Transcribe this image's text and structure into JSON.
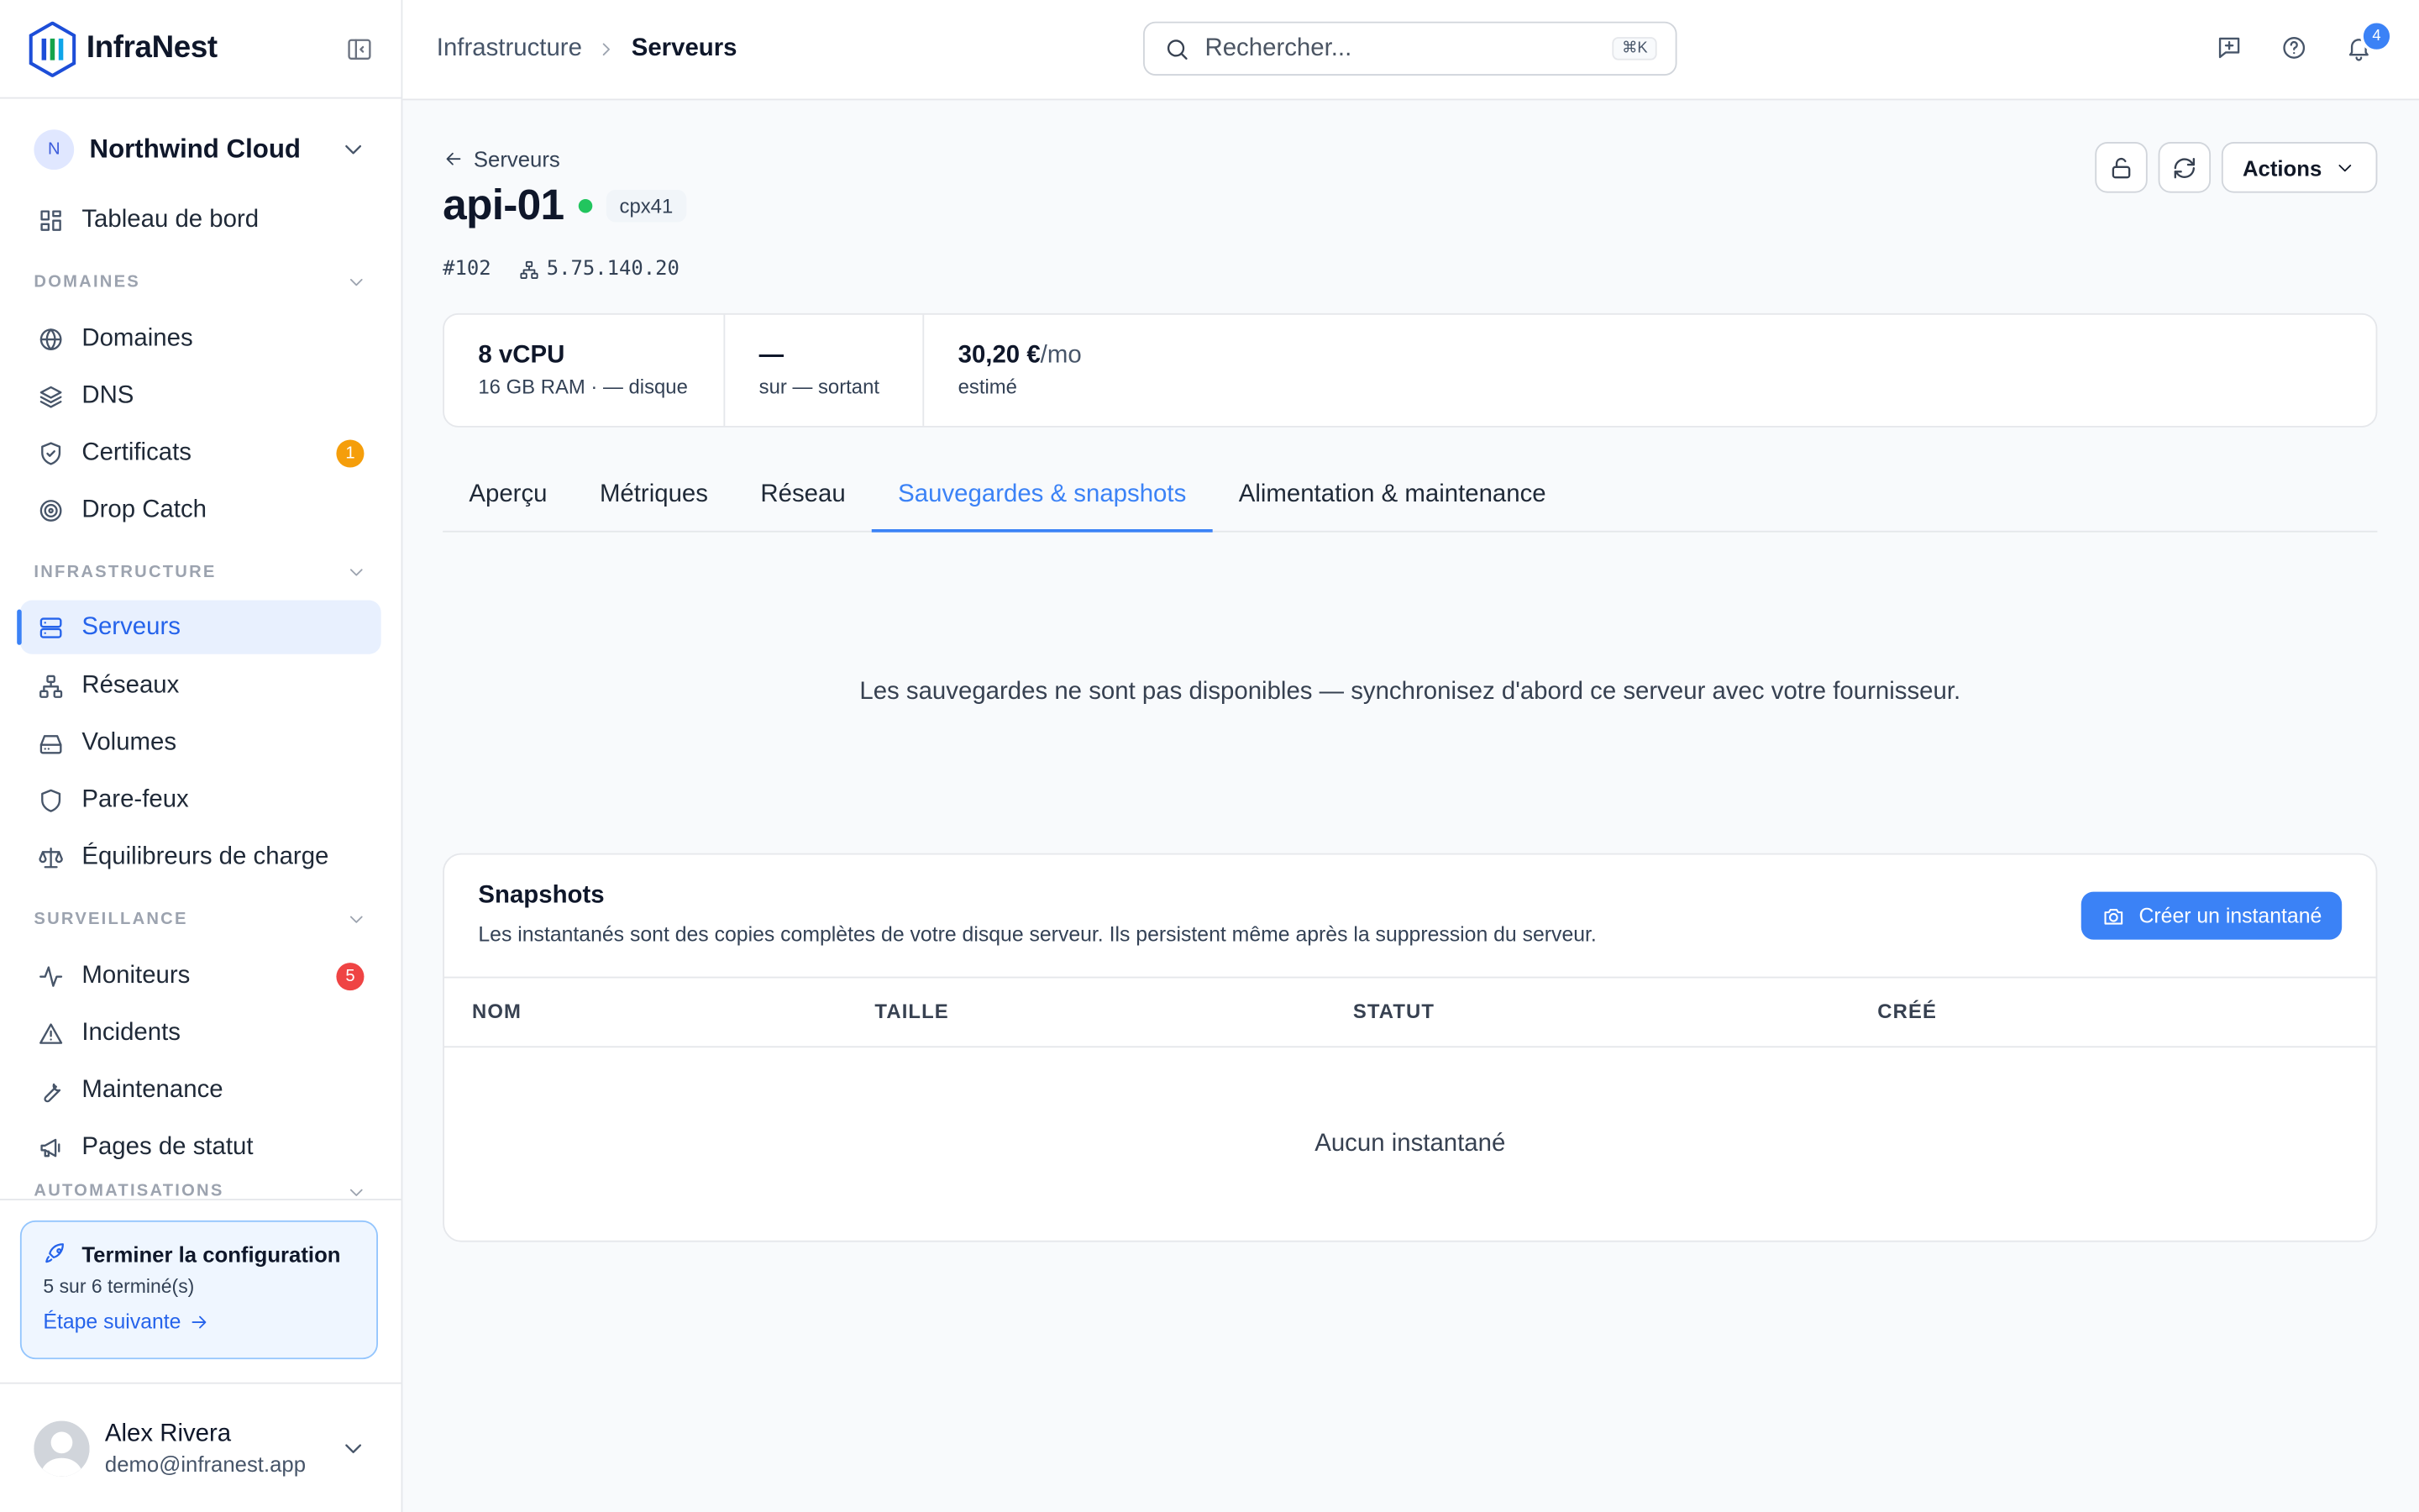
{
  "app": {
    "name": "InfraNest"
  },
  "org": {
    "initial": "N",
    "name": "Northwind Cloud"
  },
  "nav": {
    "dashboard": "Tableau de bord",
    "sections": {
      "domains": "DOMAINES",
      "infrastructure": "INFRASTRUCTURE",
      "monitoring": "SURVEILLANCE",
      "automations": "AUTOMATISATIONS"
    },
    "domains": [
      "Domaines",
      "DNS",
      "Certificats",
      "Drop Catch"
    ],
    "infrastructure": [
      "Serveurs",
      "Réseaux",
      "Volumes",
      "Pare-feux",
      "Équilibreurs de charge"
    ],
    "monitoring": [
      "Moniteurs",
      "Incidents",
      "Maintenance",
      "Pages de statut"
    ],
    "badges": {
      "certificates": "1",
      "monitors": "5"
    },
    "badge_colors": {
      "certificates": "#f59e0b",
      "monitors": "#ef4444"
    }
  },
  "setup": {
    "title": "Terminer la configuration",
    "progress": "5 sur 6 terminé(s)",
    "next": "Étape suivante"
  },
  "user": {
    "name": "Alex Rivera",
    "email": "demo@infranest.app"
  },
  "header": {
    "breadcrumb": [
      "Infrastructure",
      "Serveurs"
    ],
    "search_placeholder": "Rechercher...",
    "search_shortcut": "⌘K",
    "notifications_count": "4"
  },
  "server": {
    "back_label": "Serveurs",
    "name": "api-01",
    "status_color": "#22c55e",
    "type": "cpx41",
    "id": "#102",
    "ip": "5.75.140.20",
    "actions_label": "Actions"
  },
  "stats": [
    {
      "value": "8 vCPU",
      "unit": "",
      "label": "16 GB RAM · — disque"
    },
    {
      "value": "—",
      "unit": "",
      "label": "sur — sortant"
    },
    {
      "value": "30,20 €",
      "unit": "/mo",
      "label": "estimé"
    }
  ],
  "tabs": [
    "Aperçu",
    "Métriques",
    "Réseau",
    "Sauvegardes & snapshots",
    "Alimentation & maintenance"
  ],
  "active_tab": "Sauvegardes & snapshots",
  "backups_message": "Les sauvegardes ne sont pas disponibles — synchronisez d'abord ce serveur avec votre fournisseur.",
  "snapshots": {
    "title": "Snapshots",
    "description": "Les instantanés sont des copies complètes de votre disque serveur. Ils persistent même après la suppression du serveur.",
    "create_label": "Créer un instantané",
    "columns": [
      "NOM",
      "TAILLE",
      "STATUT",
      "CRÉÉ"
    ],
    "empty": "Aucun instantané"
  },
  "colors": {
    "accent": "#3b82f6",
    "brand": "#1d4ed8"
  }
}
